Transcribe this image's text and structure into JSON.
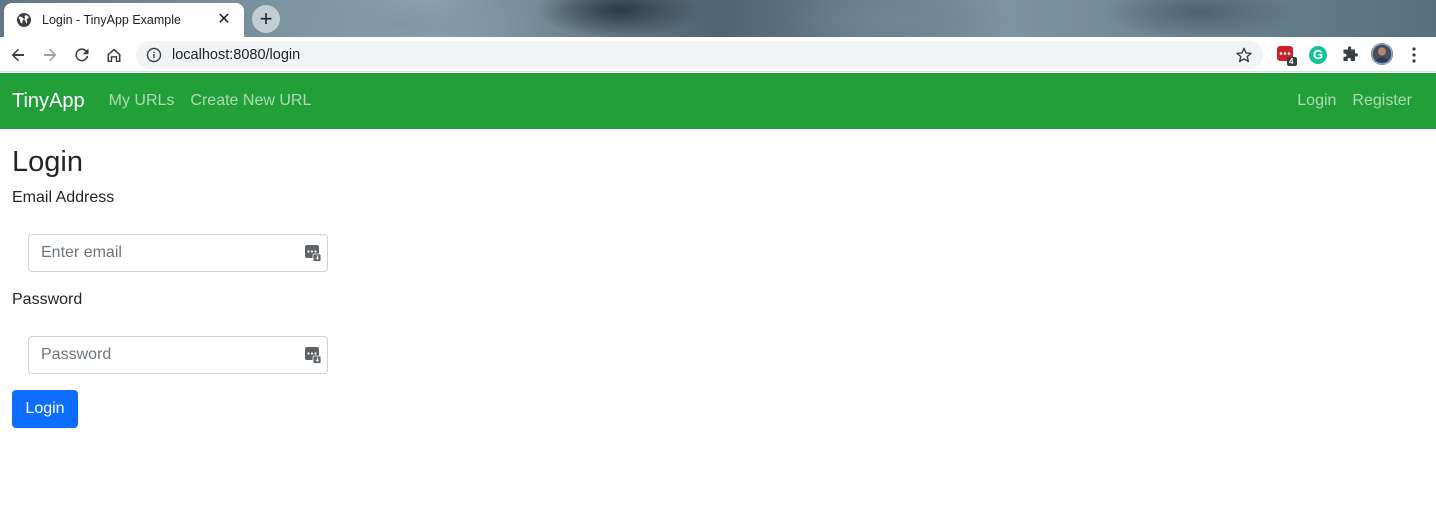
{
  "browser": {
    "tab_title": "Login - TinyApp Example",
    "url": "localhost:8080/login",
    "extension_badge": "4",
    "grammarly_letter": "G"
  },
  "navbar": {
    "brand": "TinyApp",
    "links": [
      "My URLs",
      "Create New URL"
    ],
    "right_links": [
      "Login",
      "Register"
    ]
  },
  "page": {
    "title": "Login",
    "email_label": "Email Address",
    "email_placeholder": "Enter email",
    "password_label": "Password",
    "password_placeholder": "Password",
    "submit_label": "Login"
  },
  "colors": {
    "navbar_bg": "#229f38",
    "button_bg": "#0d6efd"
  }
}
